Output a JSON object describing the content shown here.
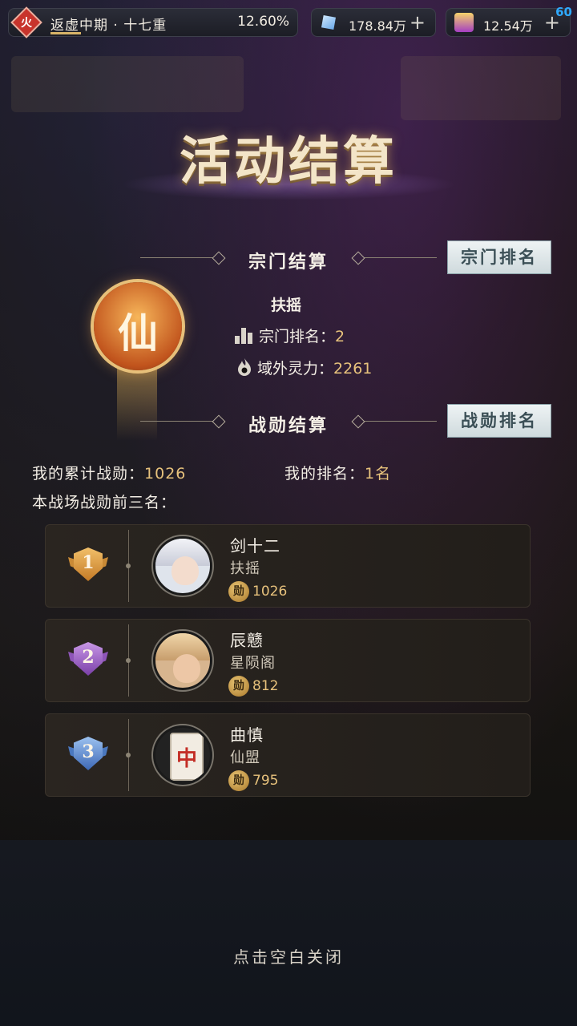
{
  "topbar": {
    "element_icon_char": "火",
    "realm": "返虚中期 · 十七重",
    "progress_text": "12.60%",
    "progress": 0.126,
    "currency1_icon": "crystal-icon",
    "currency1": "178.84万",
    "currency2_icon": "gem-icon",
    "currency2": "12.54万",
    "plus": "+",
    "fps": "60"
  },
  "title": "活动结算",
  "sect_section": {
    "header": "宗门结算",
    "rank_button": "宗门排名",
    "emblem_char": "仙",
    "sect_name": "扶摇",
    "rank_label": "宗门排名：",
    "rank_value": "2",
    "power_label": "域外灵力：",
    "power_value": "2261"
  },
  "merit_section": {
    "header": "战勋结算",
    "rank_button": "战勋排名",
    "my_total_label": "我的累计战勋：",
    "my_total_value": "1026",
    "my_rank_label": "我的排名：",
    "my_rank_value": "1名",
    "top3_label": "本战场战勋前三名："
  },
  "leaderboard": [
    {
      "rank": "1",
      "name": "剑十二",
      "sect": "扶摇",
      "coin": "勋",
      "merit": "1026"
    },
    {
      "rank": "2",
      "name": "辰戆",
      "sect": "星陨阁",
      "coin": "勋",
      "merit": "812"
    },
    {
      "rank": "3",
      "name": "曲慎",
      "sect": "仙盟",
      "coin": "勋",
      "merit": "795",
      "tile_char": "中"
    }
  ],
  "close_hint": "点击空白关闭",
  "colors": {
    "gold": "#e7c27c",
    "medal1": "#e2a043",
    "medal2": "#a66ad0",
    "medal3": "#5a8fd8"
  }
}
